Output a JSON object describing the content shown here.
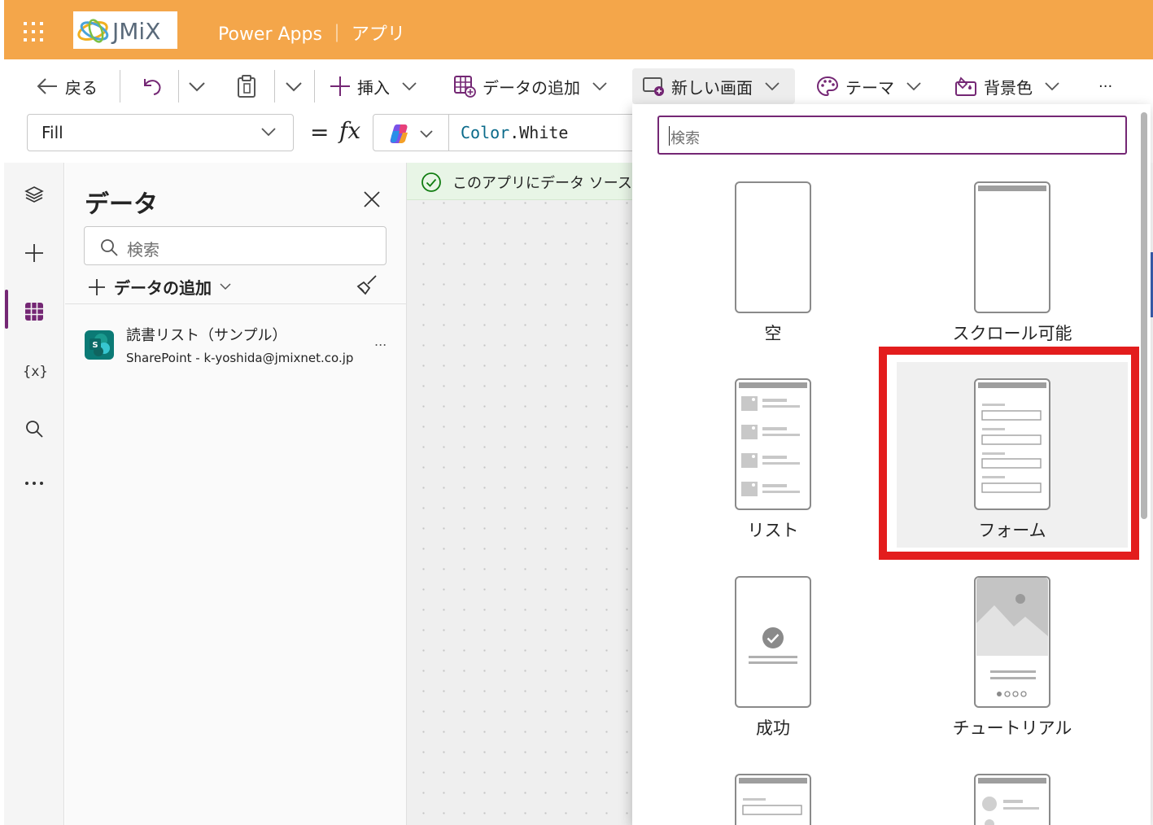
{
  "header": {
    "logo_text": "JMiX",
    "app_title": "Power Apps ｜ アプリ"
  },
  "toolbar": {
    "back_label": "戻る",
    "insert_label": "挿入",
    "add_data_label": "データの追加",
    "new_screen_label": "新しい画面",
    "theme_label": "テーマ",
    "background_label": "背景色",
    "more_label": "···"
  },
  "formula_bar": {
    "property": "Fill",
    "equals": "=",
    "fx": "fx",
    "formula_ident": "Color",
    "formula_rest": ".White"
  },
  "data_panel": {
    "title": "データ",
    "search_placeholder": "検索",
    "add_data_label": "データの追加",
    "source": {
      "name": "読書リスト（サンプル）",
      "connection": "SharePoint - k-yoshida@jmixnet.co.jp",
      "icon_letter": "S",
      "more": "..."
    }
  },
  "canvas": {
    "banner_text": "このアプリにデータ ソース"
  },
  "new_screen_menu": {
    "search_placeholder": "検索",
    "layouts": [
      {
        "label": "空",
        "icon": "blank-layout-icon"
      },
      {
        "label": "スクロール可能",
        "icon": "scrollable-layout-icon"
      },
      {
        "label": "リスト",
        "icon": "list-layout-icon"
      },
      {
        "label": "フォーム",
        "icon": "form-layout-icon",
        "highlighted": true
      },
      {
        "label": "成功",
        "icon": "success-layout-icon"
      },
      {
        "label": "チュートリアル",
        "icon": "tutorial-layout-icon"
      }
    ]
  },
  "colors": {
    "header": "#f4a64a",
    "accent": "#742774",
    "highlight": "#e31d1d",
    "sharepoint": "#0b7a75",
    "success_banner": "#e8f5e6"
  }
}
